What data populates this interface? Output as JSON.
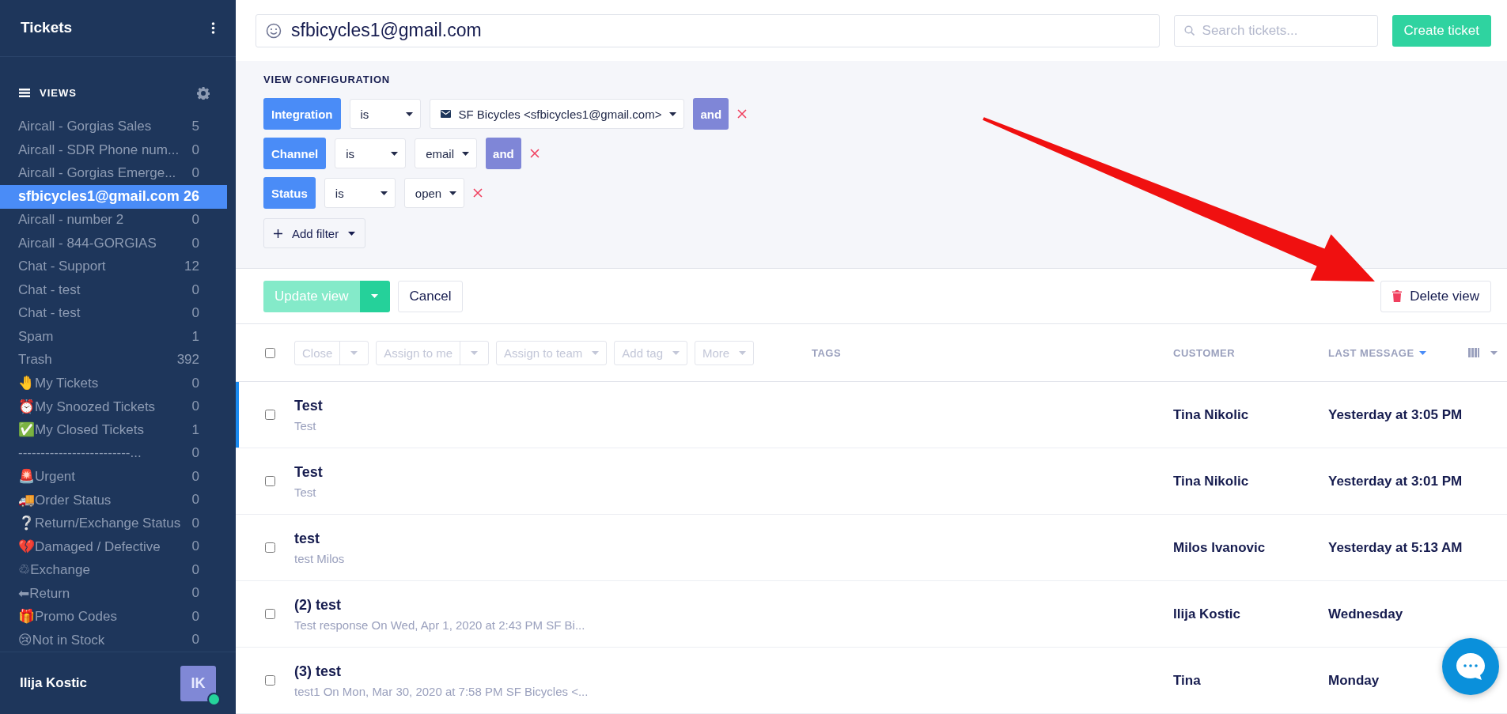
{
  "sidebar": {
    "title": "Tickets",
    "views_label": "VIEWS",
    "views": [
      {
        "name": "Aircall - Gorgias Sales",
        "count": "5",
        "selected": false
      },
      {
        "name": "Aircall - SDR Phone num...",
        "count": "0",
        "selected": false
      },
      {
        "name": "Aircall - Gorgias Emerge...",
        "count": "0",
        "selected": false
      },
      {
        "name": "sfbicycles1@gmail.com",
        "count": "26",
        "selected": true
      },
      {
        "name": "Aircall - number 2",
        "count": "0",
        "selected": false
      },
      {
        "name": "Aircall - 844-GORGIAS",
        "count": "0",
        "selected": false
      },
      {
        "name": "Chat - Support",
        "count": "12",
        "selected": false
      },
      {
        "name": "Chat - test",
        "count": "0",
        "selected": false
      },
      {
        "name": "Chat - test",
        "count": "0",
        "selected": false
      },
      {
        "name": "Spam",
        "count": "1",
        "selected": false
      },
      {
        "name": "Trash",
        "count": "392",
        "selected": false
      },
      {
        "name": "🤚My Tickets",
        "count": "0",
        "selected": false
      },
      {
        "name": "⏰My Snoozed Tickets",
        "count": "0",
        "selected": false
      },
      {
        "name": "✅My Closed Tickets",
        "count": "1",
        "selected": false
      },
      {
        "name": "-------------------------...",
        "count": "0",
        "selected": false
      },
      {
        "name": "🚨Urgent",
        "count": "0",
        "selected": false
      },
      {
        "name": "🚚Order Status",
        "count": "0",
        "selected": false
      },
      {
        "name": "❔Return/Exchange Status",
        "count": "0",
        "selected": false
      },
      {
        "name": "💔Damaged / Defective",
        "count": "0",
        "selected": false
      },
      {
        "name": "♲Exchange",
        "count": "0",
        "selected": false
      },
      {
        "name": "⬅Return",
        "count": "0",
        "selected": false
      },
      {
        "name": "🎁Promo Codes",
        "count": "0",
        "selected": false
      },
      {
        "name": "😢Not in Stock",
        "count": "0",
        "selected": false
      }
    ],
    "user": {
      "name": "Ilija Kostic",
      "initials": "IK",
      "online": true
    }
  },
  "header": {
    "view_name": "sfbicycles1@gmail.com",
    "search": {
      "placeholder": "Search tickets..."
    },
    "create_button": "Create ticket"
  },
  "view_configuration": {
    "title": "VIEW CONFIGURATION",
    "filters": [
      {
        "field": "Integration",
        "operator": "is",
        "kind": "integration",
        "value": "SF Bicycles <sfbicycles1@gmail.com>",
        "connector": "and"
      },
      {
        "field": "Channel",
        "operator": "is",
        "kind": "select",
        "value": "email",
        "connector": "and"
      },
      {
        "field": "Status",
        "operator": "is",
        "kind": "select",
        "value": "open"
      }
    ],
    "add_filter": "Add filter"
  },
  "actions": {
    "update": {
      "label": "Update view",
      "disabled": true
    },
    "cancel": "Cancel",
    "delete": "Delete view"
  },
  "table": {
    "select_all": {
      "checked": false
    },
    "bulk_actions": [
      {
        "label": "Close",
        "split": true,
        "disabled": true
      },
      {
        "label": "Assign to me",
        "split": true,
        "disabled": true
      },
      {
        "label": "Assign to team",
        "split": false,
        "disabled": true
      },
      {
        "label": "Add tag",
        "split": false,
        "disabled": true
      },
      {
        "label": "More",
        "split": false,
        "disabled": true
      }
    ],
    "columns": [
      {
        "label": "TAGS",
        "sorted": false
      },
      {
        "label": "CUSTOMER",
        "sorted": false
      },
      {
        "label": "LAST MESSAGE",
        "sorted": true
      }
    ],
    "rows": [
      {
        "title": "Test",
        "preview": "Test",
        "customer": "Tina Nikolic",
        "last_message": "Yesterday at 3:05 PM",
        "selected": true,
        "checked": false
      },
      {
        "title": "Test",
        "preview": "Test",
        "customer": "Tina Nikolic",
        "last_message": "Yesterday at 3:01 PM",
        "selected": false,
        "checked": false
      },
      {
        "title": "test",
        "preview": "test Milos",
        "customer": "Milos Ivanovic",
        "last_message": "Yesterday at 5:13 AM",
        "selected": false,
        "checked": false
      },
      {
        "title": "(2) test",
        "preview": "Test response On Wed, Apr 1, 2020 at 2:43 PM SF Bi...",
        "customer": "Ilija Kostic",
        "last_message": "Wednesday",
        "selected": false,
        "checked": false
      },
      {
        "title": "(3) test",
        "preview": "test1 On Mon, Mar 30, 2020 at 7:58 PM SF Bicycles <...",
        "customer": "Tina",
        "last_message": "Monday",
        "selected": false,
        "checked": false
      }
    ]
  }
}
